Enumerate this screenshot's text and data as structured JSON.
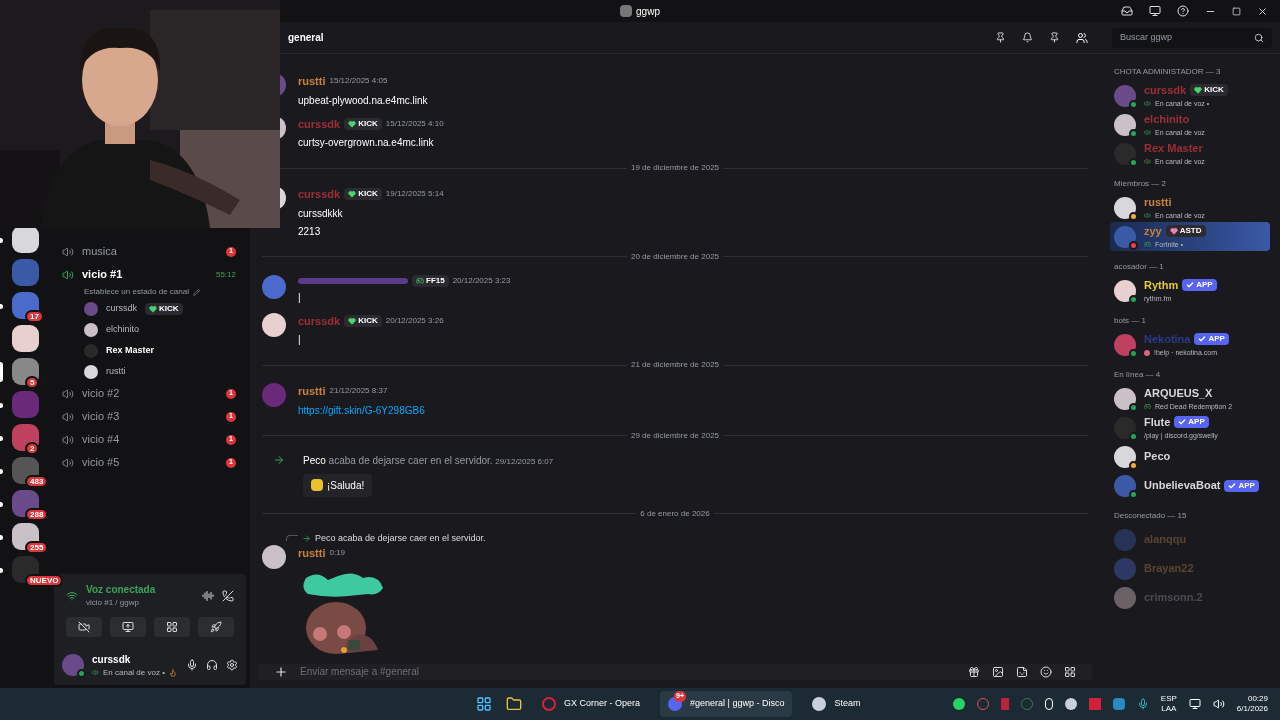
{
  "title_bar": {
    "title": "ggwp"
  },
  "servers": [
    {
      "selected": false,
      "unread": true
    },
    {
      "selected": false,
      "unread": false
    },
    {
      "selected": false,
      "unread": true,
      "badge": "17"
    },
    {
      "selected": false,
      "unread": false
    },
    {
      "selected": true,
      "unread": false,
      "badge": "5"
    },
    {
      "selected": false,
      "unread": true
    },
    {
      "selected": false,
      "unread": true,
      "badge": "2"
    },
    {
      "selected": false,
      "unread": true,
      "badge": "483"
    },
    {
      "selected": false,
      "unread": true,
      "badge": "288"
    },
    {
      "selected": false,
      "unread": true,
      "badge": "255"
    },
    {
      "selected": false,
      "unread": true,
      "badge": "NUEVO"
    }
  ],
  "channels": [
    {
      "name": "musica",
      "selected": false,
      "unread": "1"
    },
    {
      "name": "vicio #1",
      "selected": true,
      "timer": "55:12",
      "status": "Establece un estado de canal",
      "users": [
        {
          "name": "curssdk",
          "badge": "KICK"
        },
        {
          "name": "elchinito"
        },
        {
          "name": "Rex Master"
        },
        {
          "name": "rustti"
        }
      ]
    },
    {
      "name": "vicio #2",
      "selected": false,
      "unread": "1"
    },
    {
      "name": "vicio #3",
      "selected": false,
      "unread": "1"
    },
    {
      "name": "vicio #4",
      "selected": false,
      "unread": "1"
    },
    {
      "name": "vicio #5",
      "selected": false,
      "unread": "1"
    }
  ],
  "voice_panel": {
    "title": "Voz conectada",
    "subtitle": "vicio #1 / ggwp"
  },
  "user_panel": {
    "name": "curssdk",
    "status": "En canal de voz •"
  },
  "header": {
    "channel": "general",
    "search_placeholder": "Buscar ggwp"
  },
  "messages": [
    {
      "kind": "message",
      "author": "rustti",
      "color": "#c8823c",
      "time": "15/12/2025 4:05",
      "lines": [
        "upbeat-plywood.na.e4mc.link"
      ]
    },
    {
      "kind": "message",
      "author": "curssdk",
      "color": "#9c2f36",
      "badge": "KICK",
      "time": "15/12/2025 4:10",
      "lines": [
        "curtsy-overgrown.na.e4mc.link"
      ]
    },
    {
      "kind": "divider",
      "text": "19 de diciembre de 2025"
    },
    {
      "kind": "message",
      "author": "curssdk",
      "color": "#9c2f36",
      "badge": "KICK",
      "time": "19/12/2025 5:14",
      "lines": [
        "curssdkkk",
        "2213"
      ]
    },
    {
      "kind": "divider",
      "text": "20 de diciembre de 2025"
    },
    {
      "kind": "message",
      "color": "#5a3a8a",
      "badge": "FF15",
      "time": "20/12/2025 3:23",
      "lines": [
        "|"
      ]
    },
    {
      "kind": "message",
      "author": "curssdk",
      "color": "#9c2f36",
      "badge": "KICK",
      "time": "20/12/2025 3:26",
      "lines": [
        "|"
      ]
    },
    {
      "kind": "divider",
      "text": "21 de diciembre de 2025"
    },
    {
      "kind": "message",
      "author": "rustti",
      "color": "#c8823c",
      "time": "21/12/2025 8:37",
      "link": "https://gift.skin/G-6Y298GB6"
    },
    {
      "kind": "divider",
      "text": "29 de diciembre de 2025"
    },
    {
      "kind": "join",
      "user": "Peco",
      "text": "acaba de dejarse caer en el servidor.",
      "time": "29/12/2025 6:07",
      "button": "¡Saluda!"
    },
    {
      "kind": "divider",
      "text": "6 de enero de 2026"
    },
    {
      "kind": "message",
      "reply": {
        "user": "Peco",
        "text": "acaba de dejarse caer en el servidor."
      },
      "author": "rustti",
      "color": "#c8823c",
      "time": "0:19"
    }
  ],
  "composer": {
    "placeholder": "Enviar mensaje a #general"
  },
  "member_groups": [
    {
      "title": "CHOTA ADMINISTADOR — 3",
      "offline": false,
      "members": [
        {
          "name": "curssdk",
          "color": "#9c2f36",
          "badge": "KICK",
          "activity": {
            "kind": "voice",
            "text": "En canal de voz •"
          },
          "dot": {
            "color": "#23a55a"
          },
          "highlighted": false
        },
        {
          "name": "elchinito",
          "color": "#9c2f36",
          "activity": {
            "kind": "voice",
            "text": "En canal de voz"
          },
          "dot": {
            "color": "#23a55a"
          },
          "highlighted": false
        },
        {
          "name": "Rex Master",
          "color": "#9c2f36",
          "activity": {
            "kind": "voice",
            "text": "En canal de voz"
          },
          "dot": {
            "color": "#23a55a"
          },
          "highlighted": false
        }
      ]
    },
    {
      "title": "Miembros — 2",
      "offline": false,
      "members": [
        {
          "name": "rustti",
          "color": "#c8823c",
          "activity": {
            "kind": "voice",
            "text": "En canal de voz"
          },
          "dot": {
            "color": "#f0b232"
          },
          "highlighted": false
        },
        {
          "name": "zyy",
          "color": "#c8823c",
          "badge": "ASTD",
          "activity": {
            "kind": "game",
            "text": "Fortnite •"
          },
          "dot": {
            "color": "#f23f43"
          },
          "highlighted": true
        }
      ]
    },
    {
      "title": "acosador — 1",
      "offline": false,
      "members": [
        {
          "name": "Rythm",
          "color": "#e5c93a",
          "badge": "APP",
          "activity": {
            "kind": "text",
            "text": "rythm.fm"
          },
          "dot": {
            "color": "#23a55a"
          },
          "highlighted": false
        }
      ]
    },
    {
      "title": "bots — 1",
      "offline": false,
      "members": [
        {
          "name": "Nekotina",
          "color": "#2a3a8a",
          "badge": "APP",
          "activity": {
            "kind": "flower",
            "text": "!help · nekotina.com"
          },
          "dot": {
            "color": "#23a55a"
          },
          "highlighted": false
        }
      ]
    },
    {
      "title": "En línea — 4",
      "offline": false,
      "members": [
        {
          "name": "ARQUEUS_X",
          "color": "#d8d8dc",
          "activity": {
            "kind": "game",
            "text": "Red Dead Redemption 2"
          },
          "dot": {
            "color": "#23a55a"
          },
          "highlighted": false
        },
        {
          "name": "Flute",
          "color": "#d8d8dc",
          "badge": "APP",
          "activity": {
            "kind": "text",
            "text": "/play | discord.gg/swelly"
          },
          "dot": {
            "color": "#23a55a"
          },
          "highlighted": false
        },
        {
          "name": "Peco",
          "color": "#d8d8dc",
          "dot": {
            "color": "#f0b232"
          },
          "highlighted": false
        },
        {
          "name": "UnbelievaBoat",
          "color": "#d8d8dc",
          "badge": "APP",
          "dot": {
            "color": "#23a55a"
          },
          "highlighted": false
        }
      ]
    },
    {
      "title": "Desconectado — 15",
      "offline": true,
      "members": [
        {
          "name": "alanqqu",
          "color": "#5a4630",
          "highlighted": false
        },
        {
          "name": "Brayan22",
          "color": "#5a4630",
          "highlighted": false
        },
        {
          "name": "crimsonn.2",
          "color": "#4a4a50",
          "highlighted": false
        }
      ]
    }
  ],
  "taskbar": {
    "apps": [
      {
        "label": "GX Corner - Opera",
        "kind": "opera",
        "selected": false
      },
      {
        "label": "#general | ggwp - Disco",
        "kind": "discord",
        "badge": "9+",
        "selected": true
      },
      {
        "label": "Steam",
        "kind": "steam",
        "selected": false
      }
    ],
    "lang": [
      "ESP",
      "LAA"
    ],
    "time": "00:29",
    "date": "6/1/2026"
  }
}
